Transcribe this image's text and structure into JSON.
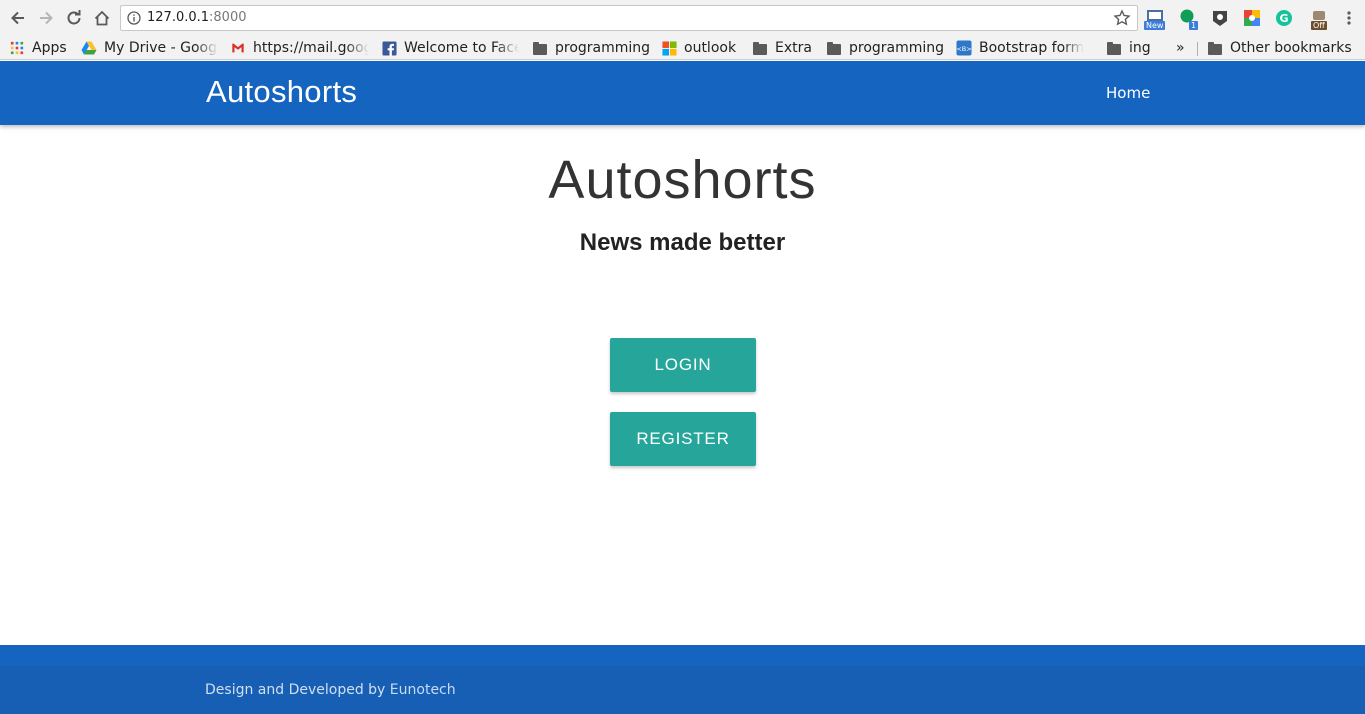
{
  "browser": {
    "url_host": "127.0.0.1",
    "url_port": ":8000",
    "extensions": [
      {
        "name": "new-extension-icon",
        "badge": "New",
        "badge_color": "#3b7ddd"
      },
      {
        "name": "hangouts-extension-icon",
        "badge": "1",
        "badge_color": "#3b7ddd"
      },
      {
        "name": "keeper-extension-icon",
        "badge": ""
      },
      {
        "name": "google-extension-icon",
        "badge": ""
      },
      {
        "name": "grammarly-extension-icon",
        "badge": ""
      },
      {
        "name": "off-extension-icon",
        "badge": "Off",
        "badge_color": "#6b4f2e"
      }
    ]
  },
  "bookmarks": {
    "items": [
      {
        "label": "Apps",
        "icon": "apps-grid-icon"
      },
      {
        "label": "My Drive - Google",
        "icon": "drive-icon"
      },
      {
        "label": "https://mail.google",
        "icon": "gmail-icon"
      },
      {
        "label": "Welcome to Facebook",
        "icon": "facebook-icon"
      },
      {
        "label": "programming",
        "icon": "folder-icon"
      },
      {
        "label": "outlook",
        "icon": "windows-icon"
      },
      {
        "label": "Extra",
        "icon": "folder-icon"
      },
      {
        "label": "programming",
        "icon": "folder-icon"
      },
      {
        "label": "Bootstrap form",
        "icon": "bootstrap-icon"
      },
      {
        "label": "ing",
        "icon": "folder-icon"
      }
    ],
    "overflow": "»",
    "other": "Other bookmarks"
  },
  "navbar": {
    "brand": "Autoshorts",
    "home_link": "Home",
    "color": "#1565c0"
  },
  "hero": {
    "title": "Autoshorts",
    "subtitle": "News made better"
  },
  "buttons": {
    "login": "LOGIN",
    "register": "REGISTER",
    "color": "#26a69a"
  },
  "footer": {
    "text": "Design and Developed by ",
    "link": "Eunotech"
  }
}
